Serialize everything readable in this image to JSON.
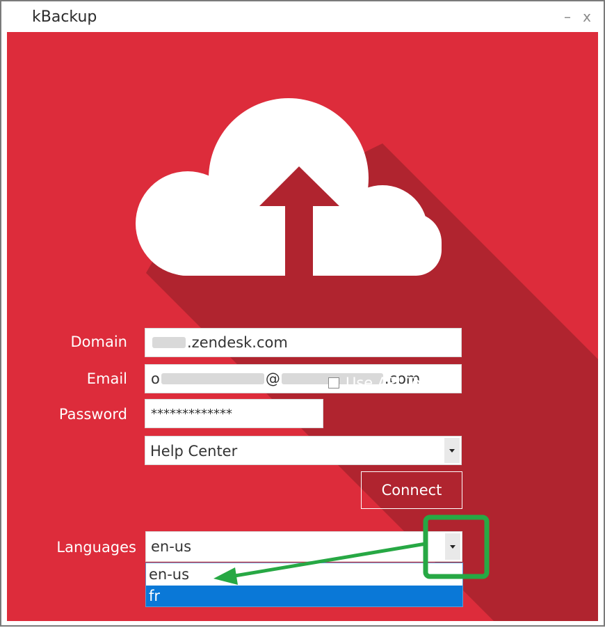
{
  "window": {
    "title": "kBackup",
    "minimize_glyph": "–",
    "close_glyph": "x"
  },
  "form": {
    "domain_label": "Domain",
    "domain_value": ".zendesk.com",
    "email_label": "Email",
    "email_prefix": "o",
    "email_at": "@",
    "email_suffix": ".com",
    "password_label": "Password",
    "password_value": "*************",
    "api_token_label": "Use API Token",
    "api_token_checked": false,
    "mode_value": "Help Center",
    "connect_label": "Connect",
    "languages_label": "Languages",
    "languages_value": "en-us",
    "languages_options": [
      "en-us",
      "fr"
    ],
    "languages_highlighted": "fr"
  },
  "icons": {
    "hero": "cloud-upload-icon",
    "dropdown": "chevron-down-icon"
  },
  "colors": {
    "background": "#dd2c3b",
    "shadow": "#b0242f",
    "highlight": "#0a78d7",
    "annotation": "#27a844"
  }
}
